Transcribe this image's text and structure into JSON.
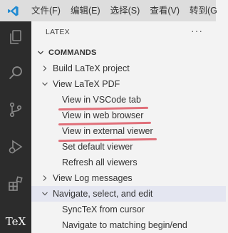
{
  "menubar": {
    "items": [
      "文件(F)",
      "编辑(E)",
      "选择(S)",
      "查看(V)",
      "转到(G"
    ]
  },
  "activity_bar": {
    "tex_label": "TeX"
  },
  "sidebar": {
    "title": "LATEX",
    "more": "···",
    "section": {
      "label": "COMMANDS"
    },
    "rows": [
      "Build LaTeX project",
      "View LaTeX PDF",
      "View in VSCode tab",
      "View in web browser",
      "View in external viewer",
      "Set default viewer",
      "Refresh all viewers",
      "View Log messages",
      "Navigate, select, and edit",
      "SyncTeX from cursor",
      "Navigate to matching begin/end"
    ]
  },
  "colors": {
    "accent_underline": "#e0707a",
    "activity_bar": "#2c2c2c",
    "selected_row": "#e4e6f1"
  }
}
